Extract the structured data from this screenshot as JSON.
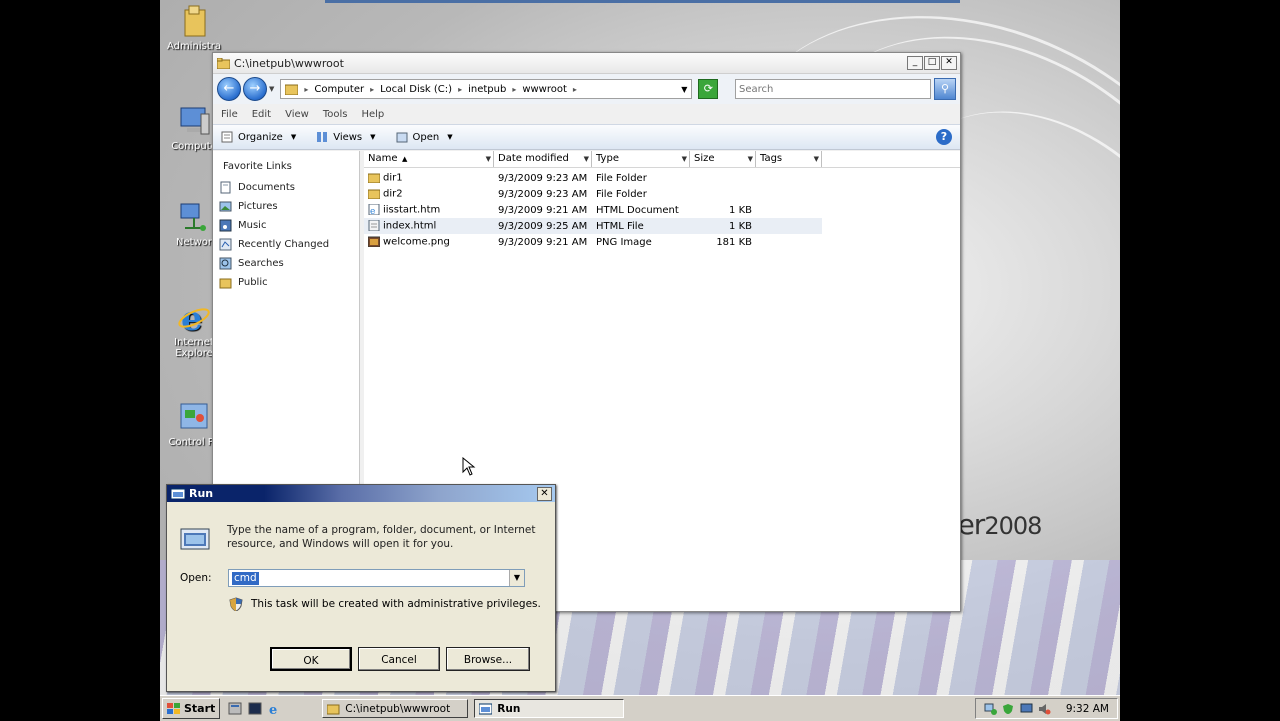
{
  "desktop": {
    "icons": [
      {
        "label": "Administra",
        "name": "desktop-icon-administrator"
      },
      {
        "label": "Compute",
        "name": "desktop-icon-computer"
      },
      {
        "label": "Networ",
        "name": "desktop-icon-network"
      },
      {
        "label": "Internet Explore",
        "name": "desktop-icon-internet-explorer"
      },
      {
        "label": "Control Pa",
        "name": "desktop-icon-control-panel"
      }
    ],
    "brand_text": "ver",
    "brand_year": "2008"
  },
  "explorer": {
    "title": "C:\\inetpub\\wwwroot",
    "window_buttons": {
      "minimize": "_",
      "maximize": "□",
      "close": "✕"
    },
    "breadcrumb": [
      "Computer",
      "Local Disk (C:)",
      "inetpub",
      "wwwroot"
    ],
    "search_placeholder": "Search",
    "menu": [
      "File",
      "Edit",
      "View",
      "Tools",
      "Help"
    ],
    "toolbar": {
      "organize": "Organize",
      "views": "Views",
      "open": "Open"
    },
    "favorites_title": "Favorite Links",
    "favorites": [
      "Documents",
      "Pictures",
      "Music",
      "Recently Changed",
      "Searches",
      "Public"
    ],
    "columns": [
      "Name",
      "Date modified",
      "Type",
      "Size",
      "Tags"
    ],
    "files": [
      {
        "name": "dir1",
        "date": "9/3/2009 9:23 AM",
        "type": "File Folder",
        "size": "",
        "icon": "folder"
      },
      {
        "name": "dir2",
        "date": "9/3/2009 9:23 AM",
        "type": "File Folder",
        "size": "",
        "icon": "folder"
      },
      {
        "name": "iisstart.htm",
        "date": "9/3/2009 9:21 AM",
        "type": "HTML Document",
        "size": "1 KB",
        "icon": "ie"
      },
      {
        "name": "index.html",
        "date": "9/3/2009 9:25 AM",
        "type": "HTML File",
        "size": "1 KB",
        "icon": "doc"
      },
      {
        "name": "welcome.png",
        "date": "9/3/2009 9:21 AM",
        "type": "PNG Image",
        "size": "181 KB",
        "icon": "image"
      }
    ],
    "selected_index": 3
  },
  "run": {
    "title": "Run",
    "close": "✕",
    "description": "Type the name of a program, folder, document, or Internet resource, and Windows will open it for you.",
    "open_label": "Open:",
    "open_value": "cmd",
    "admin_note": "This task will be created with administrative privileges.",
    "ok": "OK",
    "cancel": "Cancel",
    "browse": "Browse..."
  },
  "taskbar": {
    "start": "Start",
    "tasks": [
      {
        "label": "C:\\inetpub\\wwwroot",
        "active": false
      },
      {
        "label": "Run",
        "active": true
      }
    ],
    "clock": "9:32 AM"
  },
  "colors": {
    "accent": "#2b6fcf",
    "run_title": "#0a246a",
    "selection": "#316ac5"
  }
}
